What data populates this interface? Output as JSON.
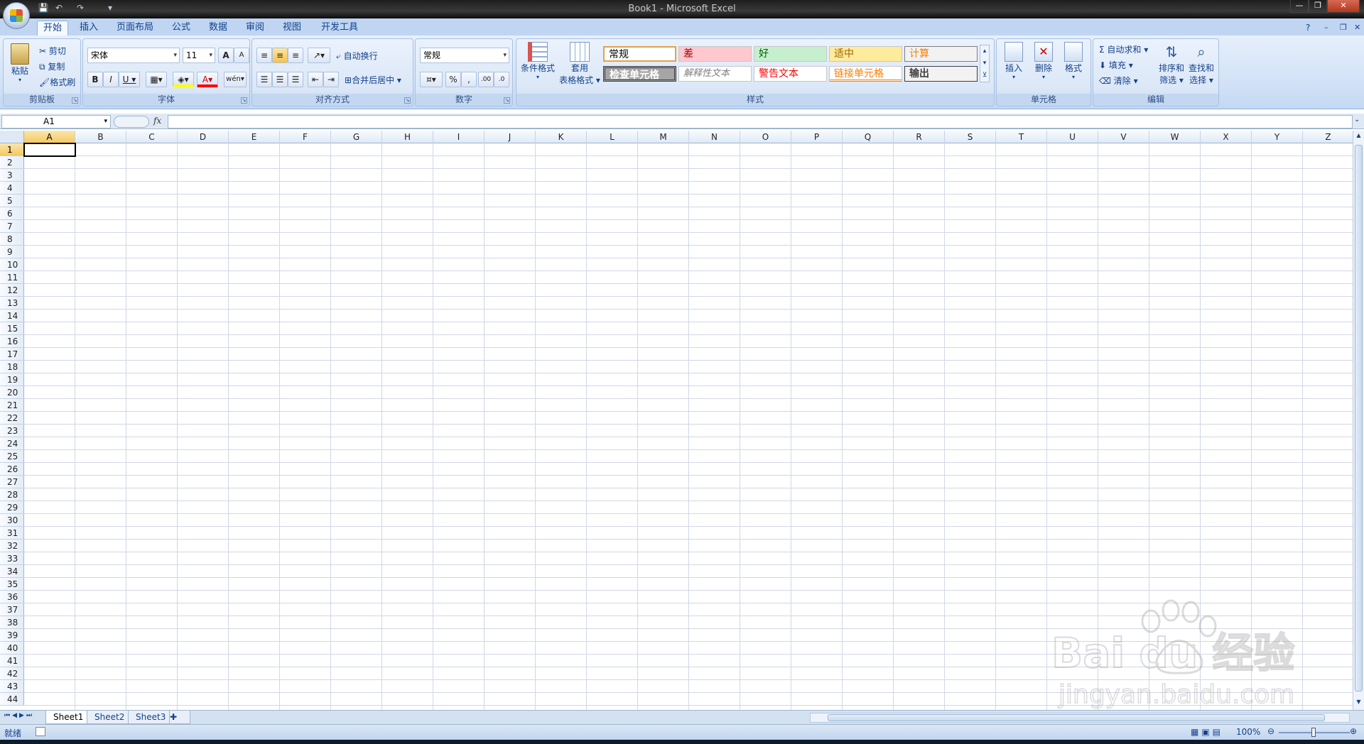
{
  "window": {
    "title": "Book1 - Microsoft Excel"
  },
  "tabs": [
    "开始",
    "插入",
    "页面布局",
    "公式",
    "数据",
    "审阅",
    "视图",
    "开发工具"
  ],
  "clipboard": {
    "paste": "粘贴",
    "cut": "剪切",
    "copy": "复制",
    "format_painter": "格式刷",
    "label": "剪贴板"
  },
  "font": {
    "name": "宋体",
    "size": "11",
    "grow": "A",
    "shrink": "A",
    "bold": "B",
    "italic": "I",
    "underline": "U",
    "label": "字体",
    "wen": "wén"
  },
  "alignment": {
    "wrap": "自动换行",
    "merge": "合并后居中",
    "label": "对齐方式"
  },
  "number": {
    "format": "常规",
    "percent": "%",
    "comma": ",",
    "inc_decimal": ".00",
    "dec_decimal": ".0",
    "label": "数字"
  },
  "styles": {
    "conditional": "条件格式",
    "table_line1": "套用",
    "table_line2": "表格格式",
    "label": "样式",
    "cells": [
      {
        "text": "常规",
        "color": "#000000",
        "bg": "#ffffff"
      },
      {
        "text": "差",
        "color": "#9c0006",
        "bg": "#ffc7ce"
      },
      {
        "text": "好",
        "color": "#006100",
        "bg": "#c6efce"
      },
      {
        "text": "适中",
        "color": "#9c6500",
        "bg": "#ffeb9c"
      },
      {
        "text": "计算",
        "color": "#fa7d00",
        "bg": "#f2f2f2"
      },
      {
        "text": "检查单元格",
        "color": "#ffffff",
        "bg": "#a5a5a5"
      },
      {
        "text": "解释性文本",
        "color": "#7f7f7f",
        "bg": "#ffffff"
      },
      {
        "text": "警告文本",
        "color": "#ff0000",
        "bg": "#ffffff"
      },
      {
        "text": "链接单元格",
        "color": "#fa7d00",
        "bg": "#ffffff"
      },
      {
        "text": "输出",
        "color": "#3f3f3f",
        "bg": "#f2f2f2"
      }
    ]
  },
  "cells_group": {
    "insert": "插入",
    "delete": "删除",
    "format": "格式",
    "label": "单元格"
  },
  "editing": {
    "autosum": "自动求和",
    "fill": "填充",
    "clear": "清除",
    "sort_line1": "排序和",
    "sort_line2": "筛选",
    "find_line1": "查找和",
    "find_line2": "选择",
    "label": "编辑",
    "sigma": "Σ"
  },
  "formula_bar": {
    "name_box": "A1",
    "fx": "fx",
    "value": ""
  },
  "columns": [
    "A",
    "B",
    "C",
    "D",
    "E",
    "F",
    "G",
    "H",
    "I",
    "J",
    "K",
    "L",
    "M",
    "N",
    "O",
    "P",
    "Q",
    "R",
    "S",
    "T",
    "U",
    "V",
    "W",
    "X",
    "Y",
    "Z"
  ],
  "selected_cell": "A1",
  "visible_rows": 44,
  "sheets": [
    "Sheet1",
    "Sheet2",
    "Sheet3"
  ],
  "active_sheet": "Sheet1",
  "status": {
    "ready": "就绪",
    "zoom": "100%"
  },
  "watermark": {
    "brand": "Bai du 经验",
    "url": "jingyan.baidu.com"
  }
}
